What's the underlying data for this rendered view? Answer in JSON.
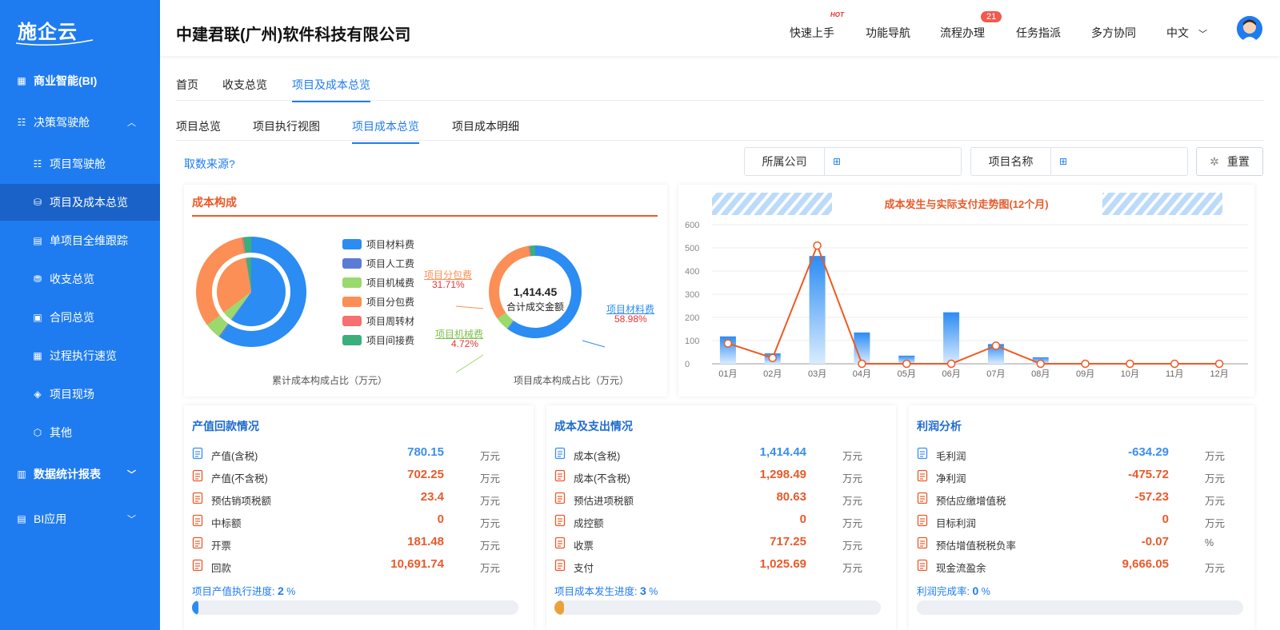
{
  "sidebar": {
    "logo": "施企云",
    "items": [
      {
        "label": "商业智能(BI)"
      },
      {
        "label": "决策驾驶舱"
      },
      {
        "label": "项目驾驶舱"
      },
      {
        "label": "项目及成本总览"
      },
      {
        "label": "单项目全维跟踪"
      },
      {
        "label": "收支总览"
      },
      {
        "label": "合同总览"
      },
      {
        "label": "过程执行速览"
      },
      {
        "label": "项目现场"
      },
      {
        "label": "其他"
      },
      {
        "label": "数据统计报表"
      },
      {
        "label": "BI应用"
      }
    ]
  },
  "header": {
    "company": "中建君联(广州)软件科技有限公司",
    "nav": {
      "quick_start": "快速上手",
      "hot": "HOT",
      "func_nav": "功能导航",
      "process": "流程办理",
      "process_badge": "21",
      "task": "任务指派",
      "collab": "多方协同",
      "lang": "中文"
    }
  },
  "tabs": {
    "main": [
      "首页",
      "收支总览",
      "项目及成本总览"
    ],
    "sub": [
      "项目总览",
      "项目执行视图",
      "项目成本总览",
      "项目成本明细"
    ]
  },
  "filters": {
    "source_link": "取数来源?",
    "company_label": "所属公司",
    "project_label": "项目名称",
    "reset": "重置"
  },
  "cost_panel": {
    "title": "成本构成",
    "legend": [
      "项目材料费",
      "项目人工费",
      "项目机械费",
      "项目分包费",
      "项目周转材",
      "项目间接费"
    ],
    "colors": [
      "#2b8cf3",
      "#5b7bd5",
      "#9ad96c",
      "#fb8f55",
      "#f86f6f",
      "#3aaf7a"
    ],
    "pie_caption": "累计成本构成占比（万元）",
    "donut_caption": "项目成本构成占比（万元）",
    "donut_total": "1,414.45",
    "donut_total_label": "合计成交金额",
    "donut_labels": {
      "subcontract": "项目分包费",
      "subcontract_pct": "31.71%",
      "machinery": "项目机械费",
      "machinery_pct": "4.72%",
      "material": "项目材料费",
      "material_pct": "58.98%"
    }
  },
  "chart_data": {
    "type": "bar",
    "title": "成本发生与实际支付走势图(12个月)",
    "categories": [
      "01月",
      "02月",
      "03月",
      "04月",
      "05月",
      "06月",
      "07月",
      "08月",
      "09月",
      "10月",
      "11月",
      "12月"
    ],
    "series": [
      {
        "values": [
          118,
          45,
          465,
          135,
          35,
          222,
          85,
          28,
          0,
          0,
          0,
          0
        ]
      },
      {
        "values": [
          88,
          25,
          510,
          0,
          0,
          0,
          78,
          0,
          0,
          0,
          0,
          0
        ]
      }
    ],
    "ylim": [
      0,
      600
    ],
    "yticks": [
      "0",
      "100",
      "200",
      "300",
      "400",
      "500",
      "600"
    ],
    "grid": true
  },
  "cards": [
    {
      "title": "产值回款情况",
      "rows": [
        {
          "label": "产值(含税)",
          "value": "780.15",
          "unit": "万元"
        },
        {
          "label": "产值(不含税)",
          "value": "702.25",
          "unit": "万元"
        },
        {
          "label": "预估销项税额",
          "value": "23.4",
          "unit": "万元"
        },
        {
          "label": "中标额",
          "value": "0",
          "unit": "万元"
        },
        {
          "label": "开票",
          "value": "181.48",
          "unit": "万元"
        },
        {
          "label": "回款",
          "value": "10,691.74",
          "unit": "万元"
        }
      ],
      "progress_label": "项目产值执行进度: ",
      "progress_value": "2",
      "progress_unit": " %",
      "progress_fraction": 0.02,
      "progress_color": "#2b8cf3"
    },
    {
      "title": "成本及支出情况",
      "rows": [
        {
          "label": "成本(含税)",
          "value": "1,414.44",
          "unit": "万元"
        },
        {
          "label": "成本(不含税)",
          "value": "1,298.49",
          "unit": "万元"
        },
        {
          "label": "预估进项税额",
          "value": "80.63",
          "unit": "万元"
        },
        {
          "label": "成控额",
          "value": "0",
          "unit": "万元"
        },
        {
          "label": "收票",
          "value": "717.25",
          "unit": "万元"
        },
        {
          "label": "支付",
          "value": "1,025.69",
          "unit": "万元"
        }
      ],
      "progress_label": "项目成本发生进度: ",
      "progress_value": "3",
      "progress_unit": " %",
      "progress_fraction": 0.03,
      "progress_color": "#e9a23b"
    },
    {
      "title": "利润分析",
      "rows": [
        {
          "label": "毛利润",
          "value": "-634.29",
          "unit": "万元"
        },
        {
          "label": "净利润",
          "value": "-475.72",
          "unit": "万元"
        },
        {
          "label": "预估应缴增值税",
          "value": "-57.23",
          "unit": "万元"
        },
        {
          "label": "目标利润",
          "value": "0",
          "unit": "万元"
        },
        {
          "label": "预估增值税税负率",
          "value": "-0.07",
          "unit": "%"
        },
        {
          "label": "现金流盈余",
          "value": "9,666.05",
          "unit": "万元"
        }
      ],
      "progress_label": "利润完成率: ",
      "progress_value": "0",
      "progress_unit": " %",
      "progress_fraction": 0,
      "progress_color": "#2b8cf3"
    }
  ]
}
